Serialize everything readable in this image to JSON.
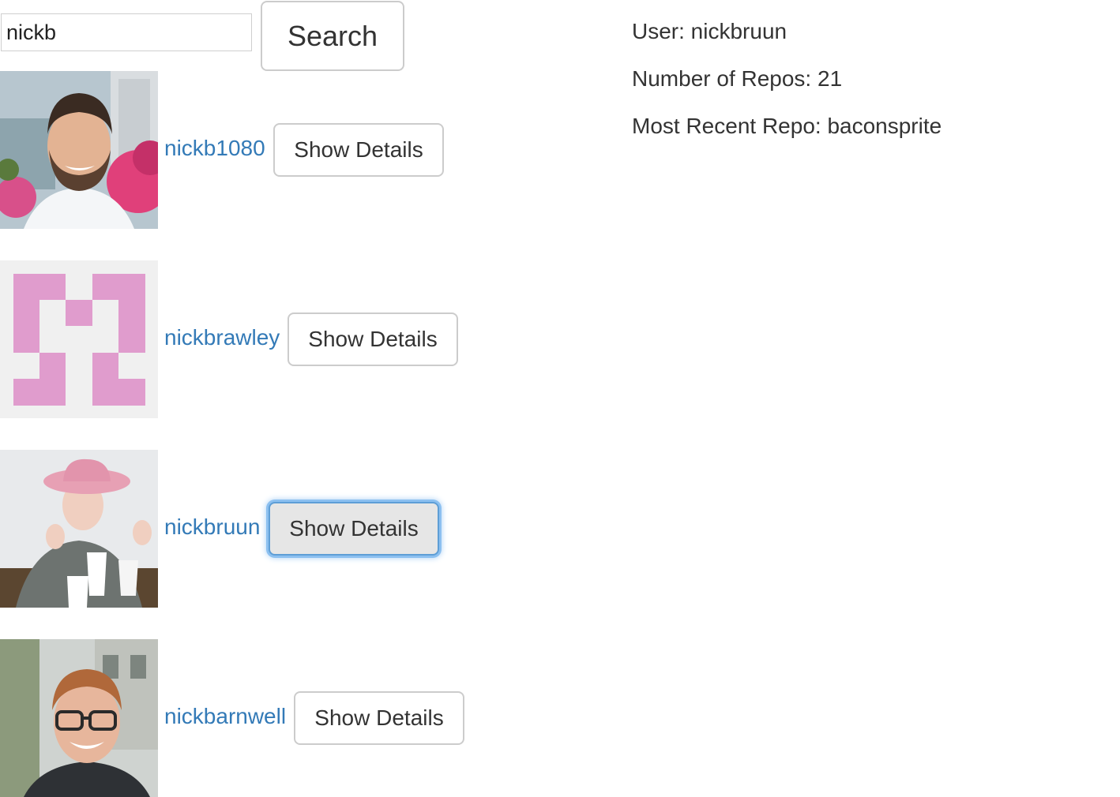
{
  "search": {
    "value": "nickb",
    "button_label": "Search"
  },
  "results": [
    {
      "login": "nickb1080",
      "button_label": "Show Details",
      "avatar": "photo-man-beard-flowers"
    },
    {
      "login": "nickbrawley",
      "button_label": "Show Details",
      "avatar": "identicon-pink"
    },
    {
      "login": "nickbruun",
      "button_label": "Show Details",
      "avatar": "photo-pink-hat-thumbs-up",
      "focused": true
    },
    {
      "login": "nickbarnwell",
      "button_label": "Show Details",
      "avatar": "photo-glasses-smile"
    }
  ],
  "details": {
    "user": "User: nickbruun",
    "repo_count": "Number of Repos: 21",
    "recent_repo": "Most Recent Repo: baconsprite"
  },
  "colors": {
    "link": "#337ab7",
    "identicon": "#e09ccd",
    "identicon_bg": "#f0f0f0",
    "focus_ring": "#8cc0f0"
  }
}
